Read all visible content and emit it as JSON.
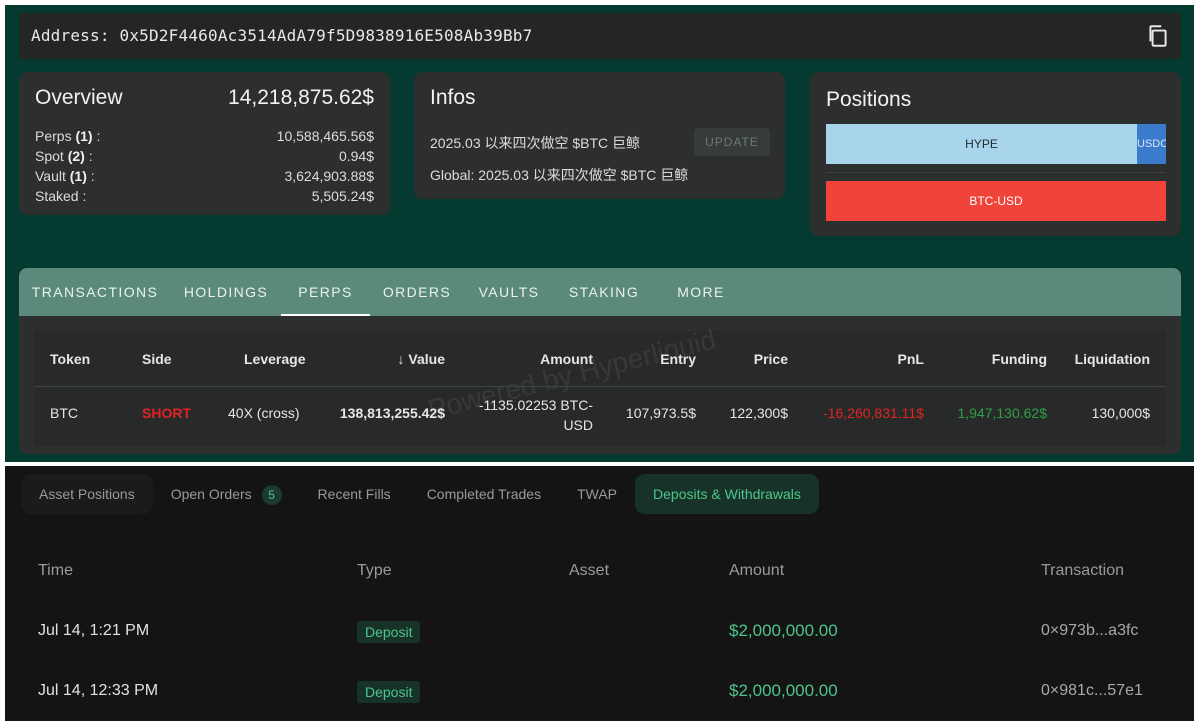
{
  "address": {
    "text": "Address: 0x5D2F4460Ac3514AdA79f5D9838916E508Ab39Bb7",
    "copy_icon": "copy-icon"
  },
  "overview": {
    "title": "Overview",
    "total": "14,218,875.62$",
    "rows": [
      {
        "label": "Perps",
        "count": "(1)",
        "suffix": " :",
        "value": "10,588,465.56$"
      },
      {
        "label": "Spot",
        "count": "(2)",
        "suffix": " :",
        "value": "0.94$"
      },
      {
        "label": "Vault",
        "count": "(1)",
        "suffix": " :",
        "value": "3,624,903.88$"
      },
      {
        "label": "Staked",
        "count": "",
        "suffix": " :",
        "value": "5,505.24$"
      }
    ]
  },
  "infos": {
    "title": "Infos",
    "line1": "2025.03 以来四次做空 $BTC 巨鲸",
    "line2": "Global: 2025.03 以来四次做空 $BTC 巨鲸",
    "update_label": "UPDATE"
  },
  "positions": {
    "title": "Positions",
    "hype": "HYPE",
    "usdc": "USDC",
    "btc": "BTC-USD"
  },
  "tabs": [
    "TRANSACTIONS",
    "HOLDINGS",
    "PERPS",
    "ORDERS",
    "VAULTS",
    "STAKING",
    "MORE"
  ],
  "active_tab": "PERPS",
  "perps_table": {
    "headers": {
      "token": "Token",
      "side": "Side",
      "leverage": "Leverage",
      "sort_arrow": "↓",
      "value": "Value",
      "amount": "Amount",
      "entry": "Entry",
      "price": "Price",
      "pnl": "PnL",
      "funding": "Funding",
      "liquidation": "Liquidation"
    },
    "row": {
      "token": "BTC",
      "side": "SHORT",
      "leverage": "40X (cross)",
      "value": "138,813,255.42$",
      "amount_line1": "-1135.02253 BTC-",
      "amount_line2": "USD",
      "entry": "107,973.5$",
      "price": "122,300$",
      "pnl": "-16,260,831.11$",
      "funding": "1,947,130.62$",
      "liquidation": "130,000$"
    },
    "watermark": "Powered by Hyperliquid",
    "colors": {
      "short": "#e02424",
      "pnl": "#e02424",
      "funding": "#2f9e44"
    }
  },
  "bottom": {
    "tabs": [
      "Asset Positions",
      "Open Orders",
      "Recent Fills",
      "Completed Trades",
      "TWAP",
      "Deposits & Withdrawals"
    ],
    "open_orders_count": "5",
    "active_tab": "Deposits & Withdrawals",
    "headers": {
      "time": "Time",
      "type": "Type",
      "asset": "Asset",
      "amount": "Amount",
      "transaction": "Transaction"
    },
    "rows": [
      {
        "time": "Jul 14, 1:21 PM",
        "type": "Deposit",
        "amount": "$2,000,000.00",
        "transaction": "0×973b...a3fc"
      },
      {
        "time": "Jul 14, 12:33 PM",
        "type": "Deposit",
        "amount": "$2,000,000.00",
        "transaction": "0×981c...57e1"
      }
    ]
  }
}
